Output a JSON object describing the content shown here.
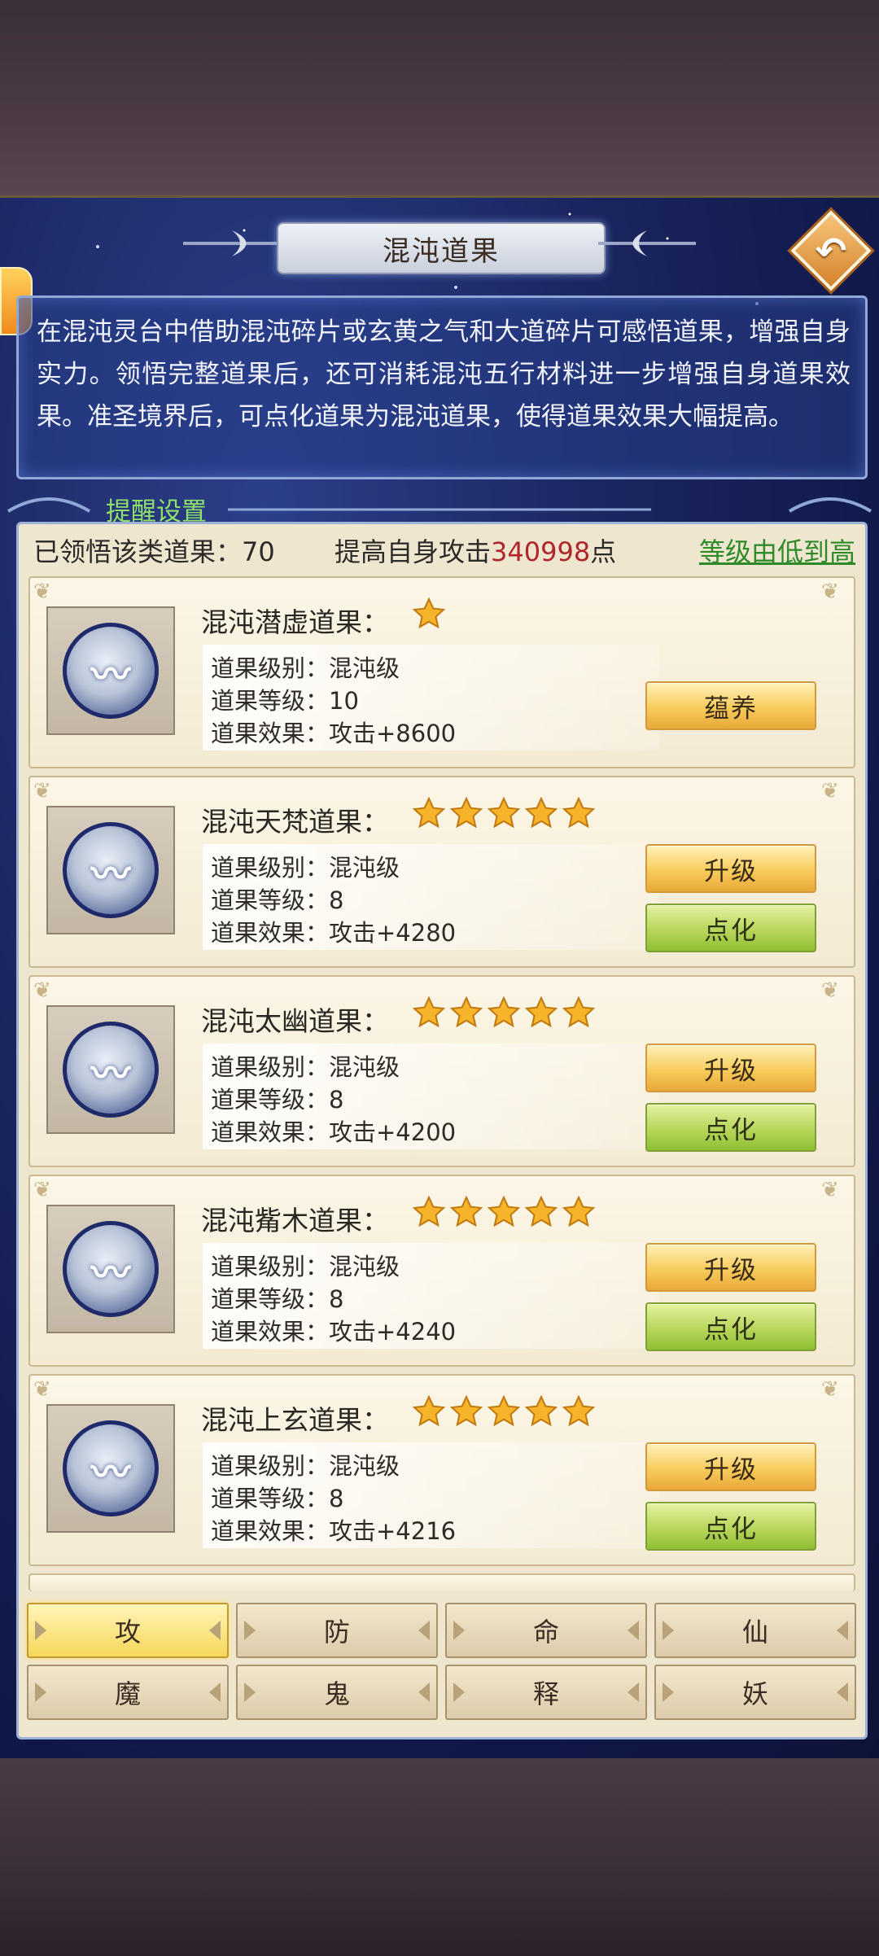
{
  "title": "混沌道果",
  "description": "在混沌灵台中借助混沌碎片或玄黄之气和大道碎片可感悟道果，增强自身实力。领悟完整道果后，还可消耗混沌五行材料进一步增强自身道果效果。准圣境界后，可点化道果为混沌道果，使得道果效果大幅提高。",
  "reminder_label": "提醒设置",
  "summary": {
    "collected_label": "已领悟该类道果：70",
    "boost_prefix": "提高自身攻击",
    "boost_value": "340998",
    "boost_suffix": "点",
    "sort_label": "等级由低到高"
  },
  "cards": [
    {
      "name": "混沌潜虚道果：",
      "stars": 1,
      "level_type": "道果级别：混沌级",
      "level": "道果等级：10",
      "effect": "道果效果：攻击+8600",
      "primary_button": "蕴养",
      "secondary_button": null
    },
    {
      "name": "混沌天梵道果：",
      "stars": 5,
      "level_type": "道果级别：混沌级",
      "level": "道果等级：8",
      "effect": "道果效果：攻击+4280",
      "primary_button": "升级",
      "secondary_button": "点化"
    },
    {
      "name": "混沌太幽道果：",
      "stars": 5,
      "level_type": "道果级别：混沌级",
      "level": "道果等级：8",
      "effect": "道果效果：攻击+4200",
      "primary_button": "升级",
      "secondary_button": "点化"
    },
    {
      "name": "混沌觜木道果：",
      "stars": 5,
      "level_type": "道果级别：混沌级",
      "level": "道果等级：8",
      "effect": "道果效果：攻击+4240",
      "primary_button": "升级",
      "secondary_button": "点化"
    },
    {
      "name": "混沌上玄道果：",
      "stars": 5,
      "level_type": "道果级别：混沌级",
      "level": "道果等级：8",
      "effect": "道果效果：攻击+4216",
      "primary_button": "升级",
      "secondary_button": "点化"
    }
  ],
  "tabs": [
    {
      "label": "攻",
      "active": true
    },
    {
      "label": "防",
      "active": false
    },
    {
      "label": "命",
      "active": false
    },
    {
      "label": "仙",
      "active": false
    },
    {
      "label": "魔",
      "active": false
    },
    {
      "label": "鬼",
      "active": false
    },
    {
      "label": "释",
      "active": false
    },
    {
      "label": "妖",
      "active": false
    }
  ],
  "colors": {
    "panel_bg": "#1b2660",
    "card_bg": "#fbf6e6",
    "star": "#f6b42a",
    "boost_value": "#b0262a",
    "sort_link": "#2f8a2a",
    "reminder": "#8fe06a"
  },
  "icons": {
    "back": "return-arrow-icon",
    "orb": "chaos-orb-icon",
    "star": "star-icon"
  }
}
